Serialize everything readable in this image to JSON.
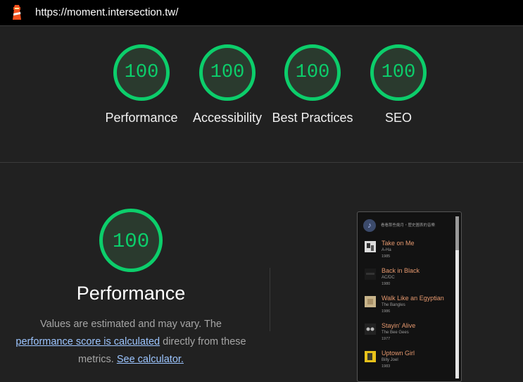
{
  "topbar": {
    "url": "https://moment.intersection.tw/",
    "icon": "lighthouse-icon"
  },
  "categories": [
    {
      "score": "100",
      "label": "Performance"
    },
    {
      "score": "100",
      "label": "Accessibility"
    },
    {
      "score": "100",
      "label": "Best Practices"
    },
    {
      "score": "100",
      "label": "SEO"
    }
  ],
  "performance": {
    "score": "100",
    "title": "Performance",
    "desc_pre": "Values are estimated and may vary. The",
    "desc_link1": "performance score is calculated",
    "desc_mid": "directly from these metrics.",
    "desc_link2": "See calculator."
  },
  "thumbnail": {
    "header": "看看那些歲月・歷史圖表的音樂",
    "songs": [
      {
        "title": "Take on Me",
        "artist": "A-Ha",
        "year": "1985"
      },
      {
        "title": "Back in Black",
        "artist": "AC/DC",
        "year": "1980"
      },
      {
        "title": "Walk Like an Egyptian",
        "artist": "The Bangles",
        "year": "1986"
      },
      {
        "title": "Stayin' Alive",
        "artist": "The Bee Gees",
        "year": "1977"
      },
      {
        "title": "Uptown Girl",
        "artist": "Billy Joel",
        "year": "1983"
      }
    ]
  },
  "colors": {
    "pass": "#0cce6b",
    "background": "#212121",
    "link": "#9cc5ff",
    "song_title": "#e5986e"
  }
}
